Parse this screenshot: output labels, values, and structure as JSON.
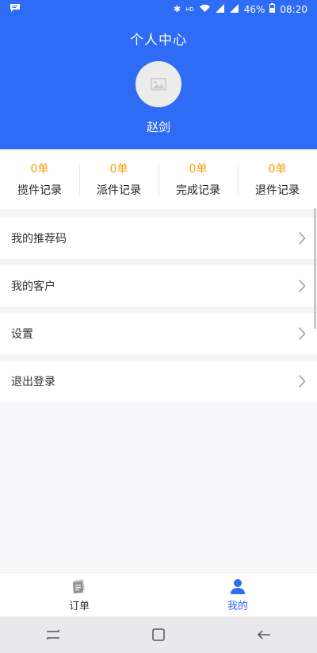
{
  "status_bar": {
    "bluetooth": "✱",
    "hd": "HD",
    "battery": "46%",
    "time": "08:20"
  },
  "header": {
    "title": "个人中心",
    "user_name": "赵剑"
  },
  "stats": [
    {
      "value": "0单",
      "label": "揽件记录"
    },
    {
      "value": "0单",
      "label": "派件记录"
    },
    {
      "value": "0单",
      "label": "完成记录"
    },
    {
      "value": "0单",
      "label": "退件记录"
    }
  ],
  "menu": [
    {
      "label": "我的推荐码"
    },
    {
      "label": "我的客户"
    },
    {
      "label": "设置"
    },
    {
      "label": "退出登录"
    }
  ],
  "tabs": [
    {
      "label": "订单"
    },
    {
      "label": "我的"
    }
  ],
  "colors": {
    "primary": "#2f6cf5",
    "accent": "#f0a30a"
  }
}
